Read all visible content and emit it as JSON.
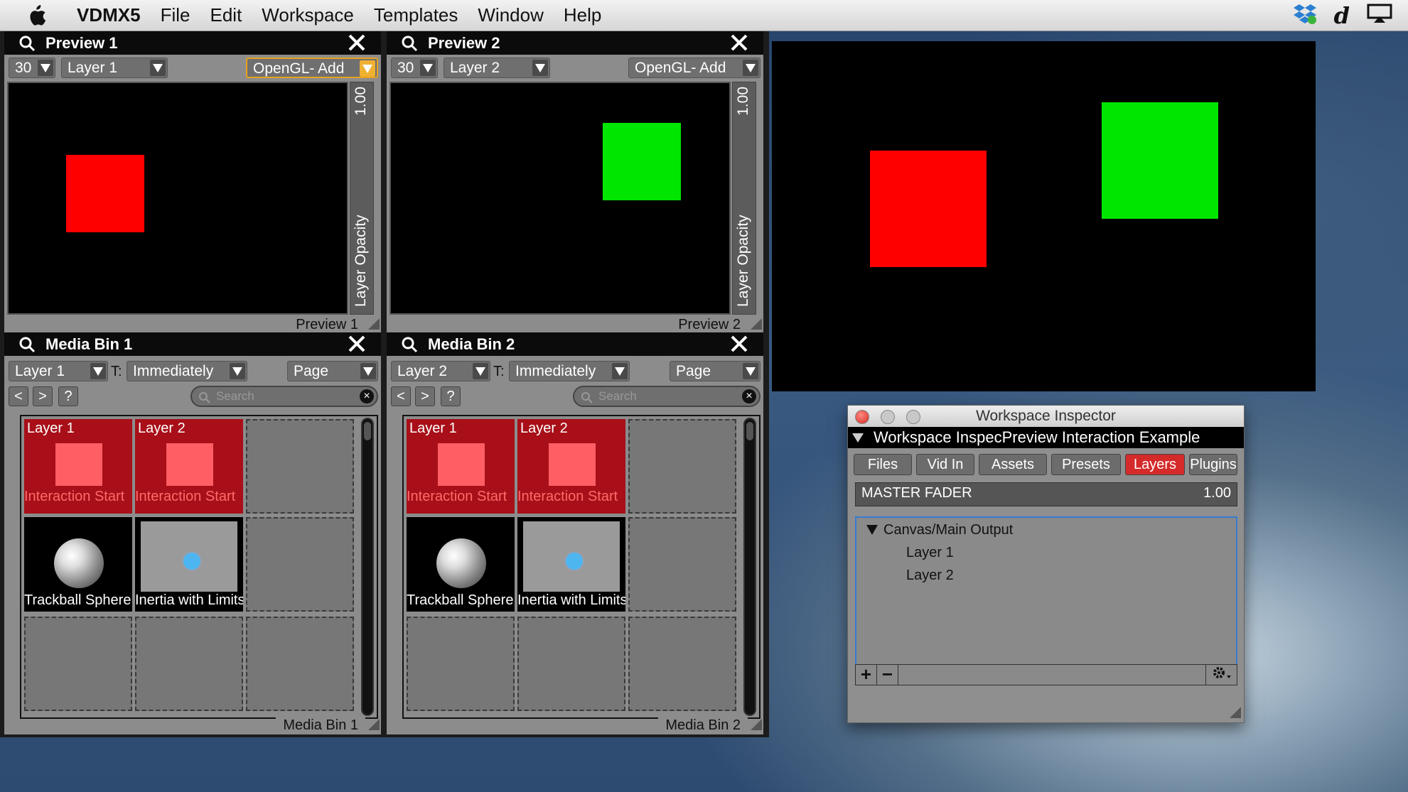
{
  "menubar": {
    "app_name": "VDMX5",
    "items": [
      "File",
      "Edit",
      "Workspace",
      "Templates",
      "Window",
      "Help"
    ]
  },
  "preview1": {
    "title": "Preview 1",
    "fps": "30",
    "layer": "Layer 1",
    "blend": "OpenGL- Add",
    "opacity_value": "1.00",
    "opacity_label": "Layer Opacity",
    "footer": "Preview 1"
  },
  "preview2": {
    "title": "Preview 2",
    "fps": "30",
    "layer": "Layer 2",
    "blend": "OpenGL- Add",
    "opacity_value": "1.00",
    "opacity_label": "Layer Opacity",
    "footer": "Preview 2"
  },
  "mediabin1": {
    "title": "Media Bin 1",
    "layer": "Layer 1",
    "t_label": "T:",
    "trigger": "Immediately",
    "page": "Page",
    "nav": [
      "<",
      ">",
      "?"
    ],
    "search_placeholder": "Search",
    "clips": [
      {
        "top": "Layer 1",
        "bottom": "Interaction Start"
      },
      {
        "top": "Layer 2",
        "bottom": "Interaction Start"
      },
      {
        "bottom": "Trackball Sphere"
      },
      {
        "bottom": "Inertia with Limits"
      }
    ],
    "footer": "Media Bin 1"
  },
  "mediabin2": {
    "title": "Media Bin 2",
    "layer": "Layer 2",
    "t_label": "T:",
    "trigger": "Immediately",
    "page": "Page",
    "nav": [
      "<",
      ">",
      "?"
    ],
    "search_placeholder": "Search",
    "clips": [
      {
        "top": "Layer 1",
        "bottom": "Interaction Start"
      },
      {
        "top": "Layer 2",
        "bottom": "Interaction Start"
      },
      {
        "bottom": "Trackball Sphere"
      },
      {
        "bottom": "Inertia with Limits"
      }
    ],
    "footer": "Media Bin 2"
  },
  "inspector": {
    "title": "Workspace Inspector",
    "header": "Workspace InspecPreview Interaction Example",
    "tabs": [
      "Files",
      "Vid In",
      "Assets",
      "Presets",
      "Layers",
      "Plugins"
    ],
    "active_tab": "Layers",
    "master_label": "MASTER FADER",
    "master_value": "1.00",
    "tree": {
      "root": "Canvas/Main Output",
      "children": [
        "Layer 1",
        "Layer 2"
      ]
    },
    "add_btn": "+",
    "remove_btn": "−"
  },
  "colors": {
    "red_square": "#ff0000",
    "green_square": "#00e600",
    "active_tab": "#d42a2a",
    "clip_red": "#a80f18"
  }
}
